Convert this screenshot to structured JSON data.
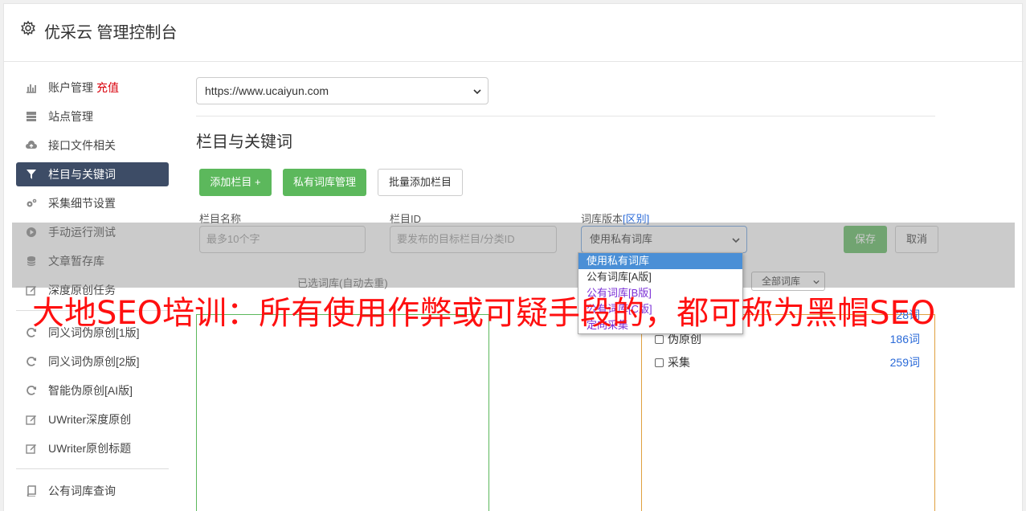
{
  "app": {
    "title": "优采云 管理控制台"
  },
  "sidebar": {
    "items": [
      {
        "label": "账户管理",
        "extra": "充值",
        "icon": "bar-chart-icon"
      },
      {
        "label": "站点管理",
        "icon": "server-icon"
      },
      {
        "label": "接口文件相关",
        "icon": "cloud-upload-icon"
      },
      {
        "label": "栏目与关键词",
        "icon": "filter-icon",
        "active": true
      },
      {
        "label": "采集细节设置",
        "icon": "gears-icon"
      },
      {
        "label": "手动运行测试",
        "icon": "play-circle-icon"
      },
      {
        "label": "文章暂存库",
        "icon": "database-icon"
      },
      {
        "label": "深度原创任务",
        "icon": "edit-icon"
      }
    ],
    "items2": [
      {
        "label": "同义词伪原创[1版]",
        "icon": "refresh-icon"
      },
      {
        "label": "同义词伪原创[2版]",
        "icon": "refresh-icon"
      },
      {
        "label": "智能伪原创[AI版]",
        "icon": "refresh-icon"
      },
      {
        "label": "UWriter深度原创",
        "icon": "edit-icon"
      },
      {
        "label": "UWriter原创标题",
        "icon": "edit-icon"
      }
    ],
    "items3": [
      {
        "label": "公有词库查询",
        "icon": "book-icon"
      }
    ]
  },
  "main": {
    "site_select": "https://www.ucaiyun.com",
    "section_title": "栏目与关键词",
    "buttons": {
      "add_column": "添加栏目 +",
      "private_lib": "私有词库管理",
      "batch_add": "批量添加栏目"
    },
    "form": {
      "name_label": "栏目名称",
      "name_placeholder": "最多10个字",
      "id_label": "栏目ID",
      "id_placeholder": "要发布的目标栏目/分类ID",
      "version_label": "词库版本",
      "version_diff": "[区别]",
      "version_value": "使用私有词库",
      "save": "保存",
      "cancel": "取消"
    },
    "dropdown_options": [
      "使用私有词库",
      "公有词库[A版]",
      "公有词库[B版]",
      "公有词库[C版]",
      "定向采集"
    ],
    "selected_title": "已选词库(自动去重)",
    "filter_select": "全部词库",
    "libraries": [
      {
        "name": "伪原创",
        "count": "186词"
      },
      {
        "name": "采集",
        "count": "259词"
      }
    ],
    "partial_count": "28词"
  },
  "watermark": "大地SEO培训：所有使用作弊或可疑手段的，都可称为黑帽SEO",
  "colors": {
    "accent_green": "#5cb85c",
    "active_nav": "#3d4c66",
    "link_blue": "#2a6ad8",
    "watermark_red": "#ff1010"
  }
}
